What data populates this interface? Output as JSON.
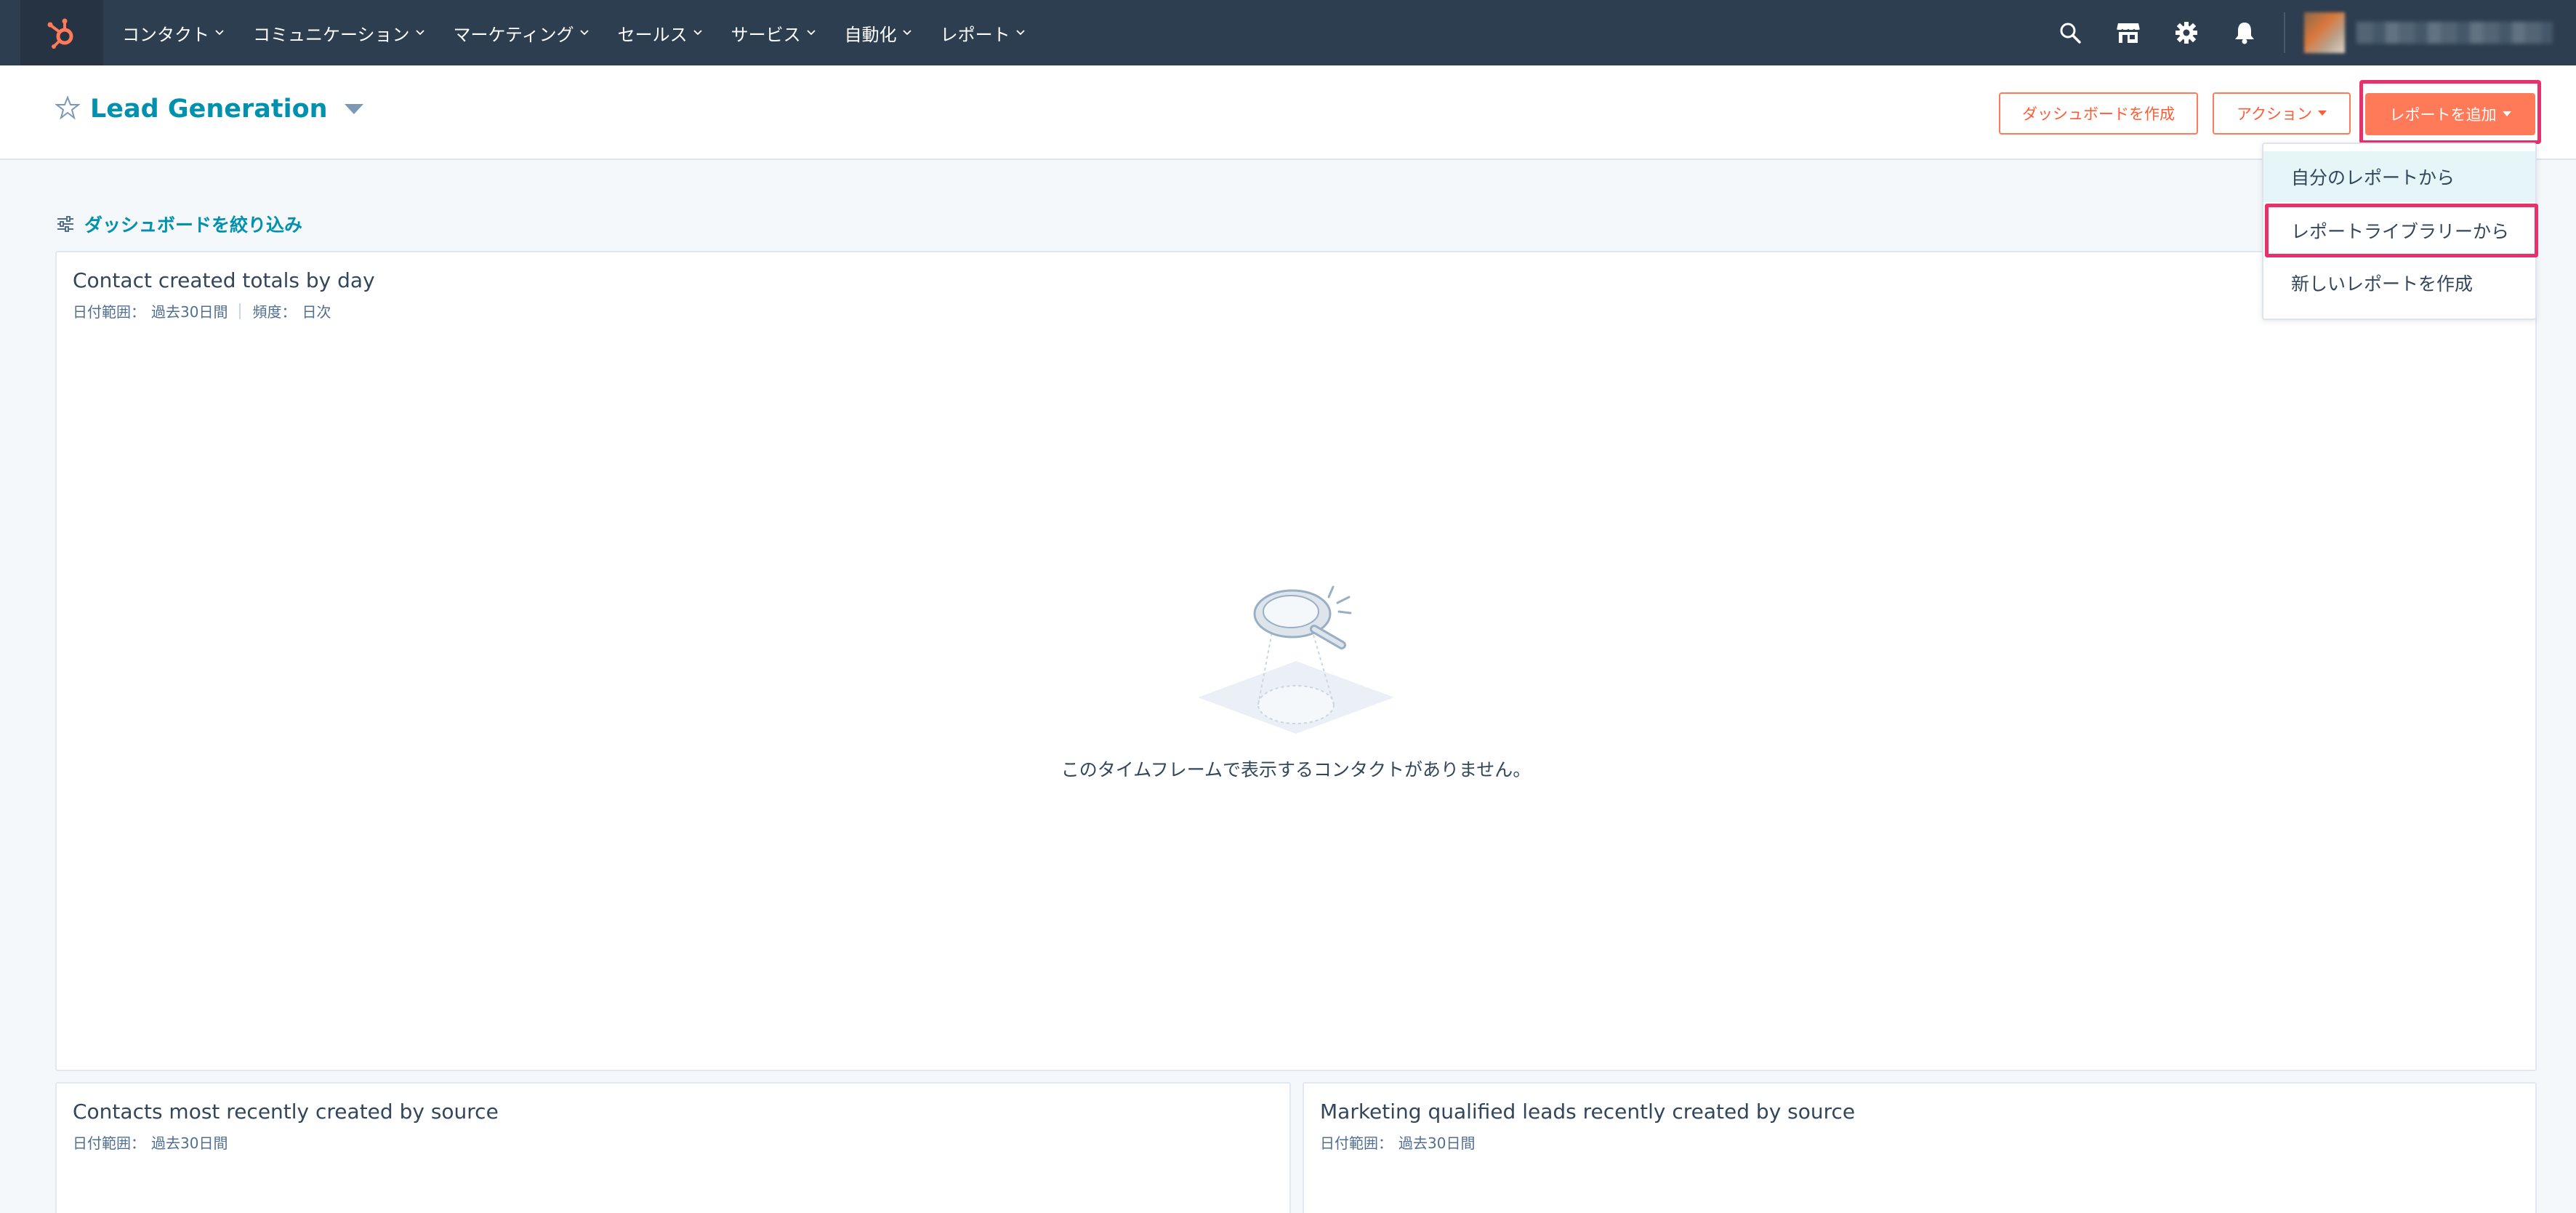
{
  "nav": {
    "items": [
      {
        "label": "コンタクト"
      },
      {
        "label": "コミュニケーション"
      },
      {
        "label": "マーケティング"
      },
      {
        "label": "セールス"
      },
      {
        "label": "サービス"
      },
      {
        "label": "自動化"
      },
      {
        "label": "レポート"
      }
    ],
    "icons": [
      "search-icon",
      "marketplace-icon",
      "settings-gear-icon",
      "notifications-bell-icon"
    ]
  },
  "header": {
    "title": "Lead Generation",
    "create_dashboard_label": "ダッシュボードを作成",
    "actions_label": "アクション",
    "add_report_label": "レポートを追加"
  },
  "add_report_menu": {
    "items": [
      {
        "label": "自分のレポートから"
      },
      {
        "label": "レポートライブラリーから"
      },
      {
        "label": "新しいレポートを作成"
      }
    ]
  },
  "filter": {
    "label": "ダッシュボードを絞り込み"
  },
  "cards": [
    {
      "title": "Contact created totals by day",
      "date_range_label": "日付範囲：",
      "date_range_value": "過去30日間",
      "frequency_label": "頻度：",
      "frequency_value": "日次",
      "empty_message": "このタイムフレームで表示するコンタクトがありません。"
    },
    {
      "title": "Contacts most recently created by source",
      "date_range_label": "日付範囲：",
      "date_range_value": "過去30日間"
    },
    {
      "title": "Marketing qualified leads recently created by source",
      "date_range_label": "日付範囲：",
      "date_range_value": "過去30日間"
    }
  ],
  "colors": {
    "nav_bg": "#2d3e50",
    "accent_orange": "#ff7a59",
    "link_teal": "#0091ae",
    "highlight_pink": "#e8306b",
    "page_bg": "#f5f8fa"
  }
}
